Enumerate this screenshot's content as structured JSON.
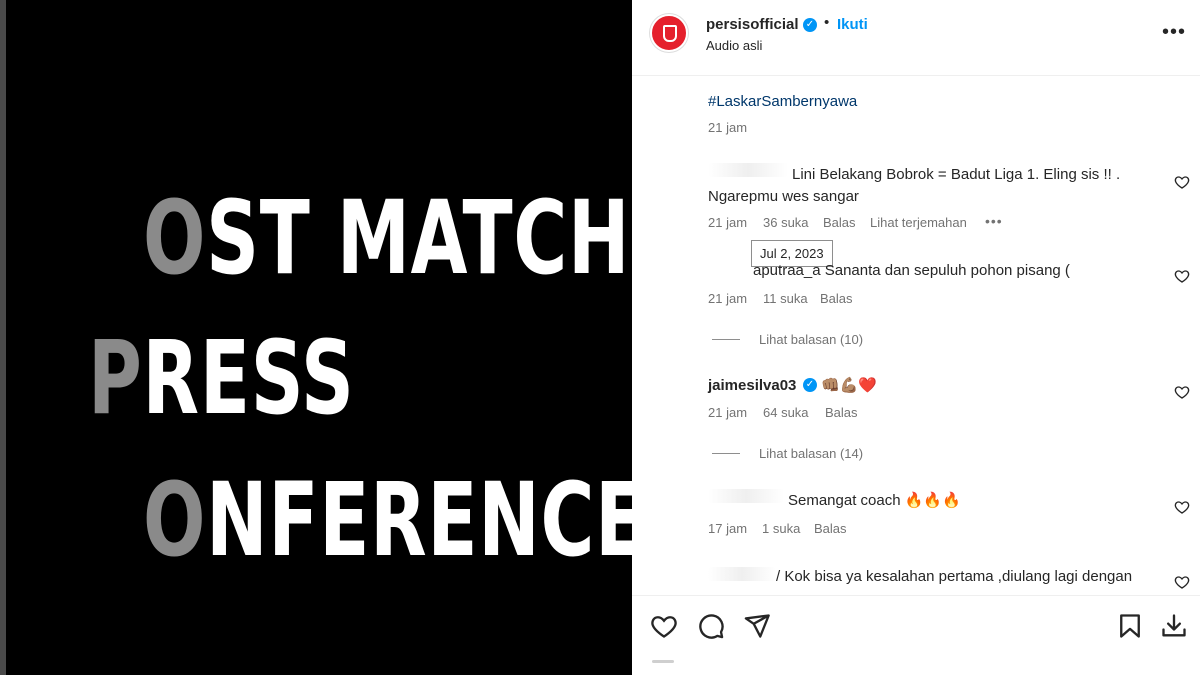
{
  "media": {
    "lines": [
      {
        "initial": "O",
        "rest": "ST MATCH"
      },
      {
        "initial": "P",
        "rest": "RESS"
      },
      {
        "initial": "O",
        "rest": "NFERENCE"
      }
    ]
  },
  "header": {
    "username": "persisofficial",
    "separator": "•",
    "follow_label": "Ikuti",
    "audio_label": "Audio asli",
    "more_label": "•••"
  },
  "caption": {
    "hashtag": "#LaskarSambernyawa",
    "time": "21 jam"
  },
  "tooltip": "Jul 2, 2023",
  "comments": [
    {
      "text_line1": "Lini Belakang Bobrok = Badut Liga 1. Eling sis !! .",
      "text_line2": "Ngarepmu wes sangar",
      "time": "21 jam",
      "likes": "36 suka",
      "reply": "Balas",
      "translate": "Lihat terjemahan",
      "more": "•••"
    },
    {
      "text_line1": "aputraa_a Sananta dan sepuluh pohon pisang (",
      "time": "21 jam",
      "likes": "11 suka",
      "reply": "Balas",
      "view_replies": "Lihat balasan (10)"
    },
    {
      "username": "jaimesilva03",
      "emojis": "👊🏽💪🏽❤️",
      "time": "21 jam",
      "likes": "64 suka",
      "reply": "Balas",
      "view_replies": "Lihat balasan (14)"
    },
    {
      "text_line1": "Semangat coach 🔥🔥🔥",
      "time": "17 jam",
      "likes": "1 suka",
      "reply": "Balas"
    },
    {
      "text_line1": "/ Kok bisa ya kesalahan pertama ,diulang lagi dengan"
    }
  ],
  "colors": {
    "accent": "#0095f6",
    "brand_red": "#e5202c",
    "text": "#262626",
    "muted": "#737373"
  },
  "icons": [
    "heart-icon",
    "comment-icon",
    "share-icon",
    "bookmark-icon",
    "download-icon",
    "more-icon"
  ]
}
